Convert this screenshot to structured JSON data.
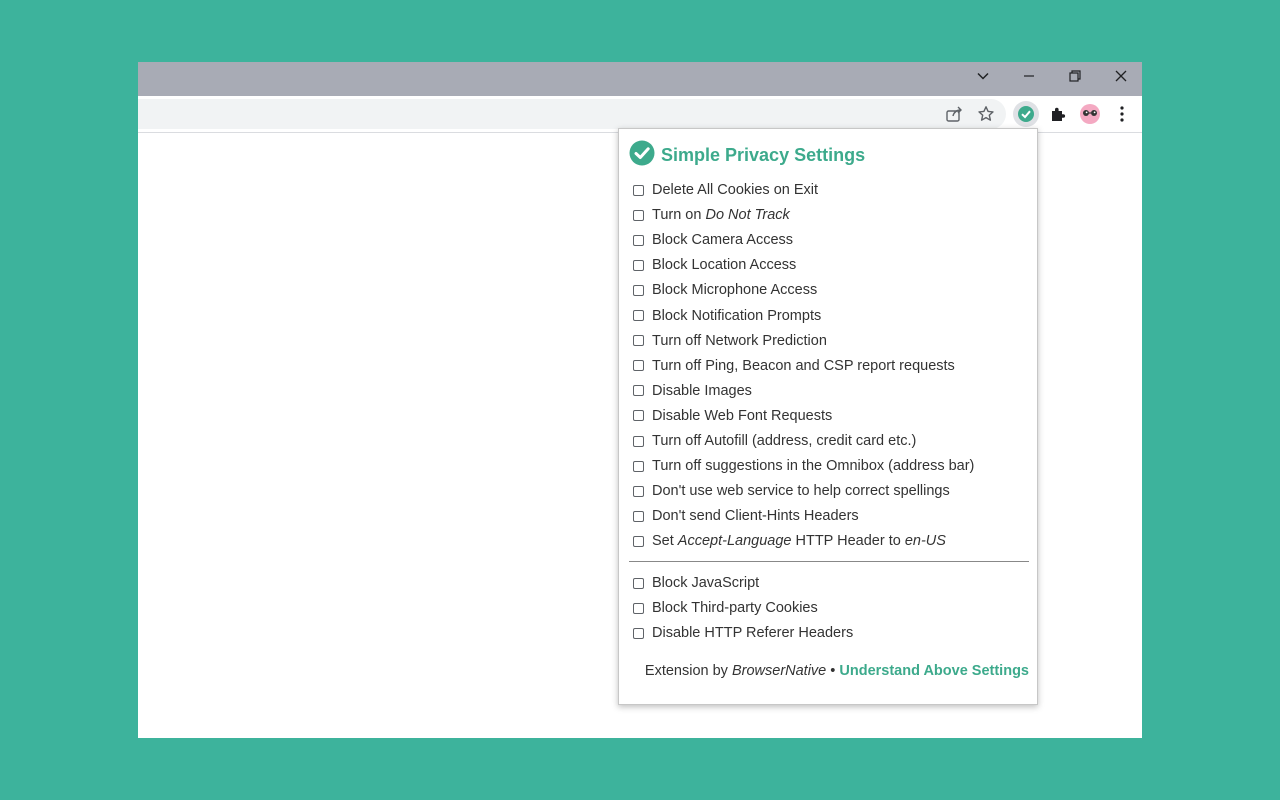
{
  "colors": {
    "background": "#3db39c",
    "accent": "#3daa8c",
    "titlebar": "#a8abb5"
  },
  "window_controls": {
    "tab_search_icon": "chevron-down-icon",
    "minimize_icon": "minimize-icon",
    "restore_icon": "restore-icon",
    "close_icon": "close-icon"
  },
  "toolbar": {
    "icons": [
      "share-icon",
      "bookmark-star-icon",
      "privacy-extension-icon",
      "extensions-puzzle-icon",
      "profile-avatar-icon",
      "menu-kebab-icon"
    ]
  },
  "popup": {
    "title": "Simple Privacy Settings",
    "title_icon": "check-circle-icon",
    "options": [
      {
        "parts": [
          {
            "text": "Delete All Cookies on Exit"
          }
        ],
        "checked": false
      },
      {
        "parts": [
          {
            "text": "Turn on "
          },
          {
            "text": "Do Not Track",
            "italic": true
          }
        ],
        "checked": false
      },
      {
        "parts": [
          {
            "text": "Block Camera Access"
          }
        ],
        "checked": false
      },
      {
        "parts": [
          {
            "text": "Block Location Access"
          }
        ],
        "checked": false
      },
      {
        "parts": [
          {
            "text": "Block Microphone Access"
          }
        ],
        "checked": false
      },
      {
        "parts": [
          {
            "text": "Block Notification Prompts"
          }
        ],
        "checked": false
      },
      {
        "parts": [
          {
            "text": "Turn off Network Prediction"
          }
        ],
        "checked": false
      },
      {
        "parts": [
          {
            "text": "Turn off Ping, Beacon and CSP report requests"
          }
        ],
        "checked": false
      },
      {
        "parts": [
          {
            "text": "Disable Images"
          }
        ],
        "checked": false
      },
      {
        "parts": [
          {
            "text": "Disable Web Font Requests"
          }
        ],
        "checked": false
      },
      {
        "parts": [
          {
            "text": "Turn off Autofill (address, credit card etc.)"
          }
        ],
        "checked": false
      },
      {
        "parts": [
          {
            "text": "Turn off suggestions in the Omnibox (address bar)"
          }
        ],
        "checked": false
      },
      {
        "parts": [
          {
            "text": "Don't use web service to help correct spellings"
          }
        ],
        "checked": false
      },
      {
        "parts": [
          {
            "text": "Don't send Client-Hints Headers"
          }
        ],
        "checked": false
      },
      {
        "parts": [
          {
            "text": "Set "
          },
          {
            "text": "Accept-Language",
            "italic": true
          },
          {
            "text": " HTTP Header to "
          },
          {
            "text": "en-US",
            "italic": true
          }
        ],
        "checked": false
      }
    ],
    "advanced_options": [
      {
        "parts": [
          {
            "text": "Block JavaScript"
          }
        ],
        "checked": false
      },
      {
        "parts": [
          {
            "text": "Block Third-party Cookies"
          }
        ],
        "checked": false
      },
      {
        "parts": [
          {
            "text": "Disable HTTP Referer Headers"
          }
        ],
        "checked": false
      }
    ],
    "footer": {
      "prefix": "Extension by ",
      "author": "BrowserNative",
      "separator": " • ",
      "link_label": "Understand Above Settings"
    }
  }
}
